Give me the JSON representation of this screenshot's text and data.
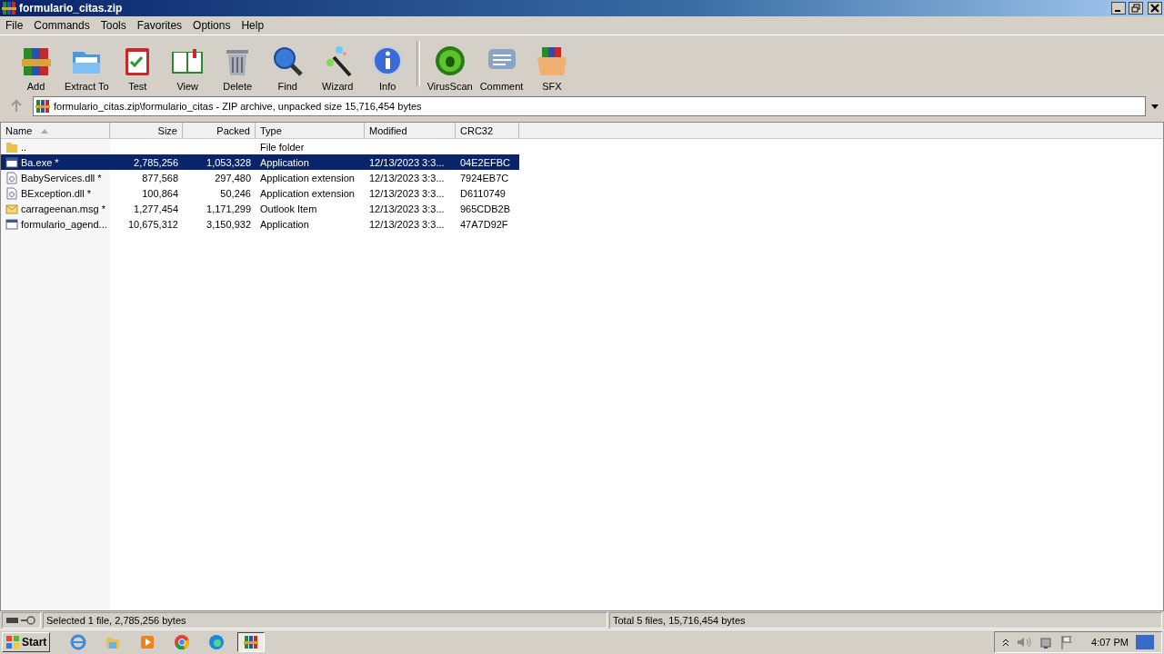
{
  "window": {
    "title": "formulario_citas.zip"
  },
  "menu": [
    "File",
    "Commands",
    "Tools",
    "Favorites",
    "Options",
    "Help"
  ],
  "toolbar": [
    {
      "label": "Add",
      "kind": "add"
    },
    {
      "label": "Extract To",
      "kind": "extract"
    },
    {
      "label": "Test",
      "kind": "test"
    },
    {
      "label": "View",
      "kind": "view"
    },
    {
      "label": "Delete",
      "kind": "delete"
    },
    {
      "label": "Find",
      "kind": "find"
    },
    {
      "label": "Wizard",
      "kind": "wizard"
    },
    {
      "label": "Info",
      "kind": "info"
    },
    {
      "label": "VirusScan",
      "kind": "virus"
    },
    {
      "label": "Comment",
      "kind": "comment"
    },
    {
      "label": "SFX",
      "kind": "sfx"
    }
  ],
  "address": "formulario_citas.zip\\formulario_citas - ZIP archive, unpacked size 15,716,454 bytes",
  "table": {
    "columns": [
      "Name",
      "Size",
      "Packed",
      "Type",
      "Modified",
      "CRC32"
    ],
    "rows": [
      {
        "kind": "folder",
        "selected": false,
        "cells": [
          "..",
          "",
          "",
          "File folder",
          "",
          ""
        ]
      },
      {
        "kind": "exe",
        "selected": true,
        "cells": [
          "Ba.exe *",
          "2,785,256",
          "1,053,328",
          "Application",
          "12/13/2023 3:3...",
          "04E2EFBC"
        ]
      },
      {
        "kind": "dll",
        "selected": false,
        "cells": [
          "BabyServices.dll *",
          "877,568",
          "297,480",
          "Application extension",
          "12/13/2023 3:3...",
          "7924EB7C"
        ]
      },
      {
        "kind": "dll",
        "selected": false,
        "cells": [
          "BException.dll *",
          "100,864",
          "50,246",
          "Application extension",
          "12/13/2023 3:3...",
          "D6110749"
        ]
      },
      {
        "kind": "msg",
        "selected": false,
        "cells": [
          "carrageenan.msg *",
          "1,277,454",
          "1,171,299",
          "Outlook Item",
          "12/13/2023 3:3...",
          "965CDB2B"
        ]
      },
      {
        "kind": "exe",
        "selected": false,
        "cells": [
          "formulario_agend...",
          "10,675,312",
          "3,150,932",
          "Application",
          "12/13/2023 3:3...",
          "47A7D92F"
        ]
      }
    ]
  },
  "status_bar": {
    "left": "Selected 1 file, 2,785,256 bytes",
    "right": "Total 5 files, 15,716,454 bytes"
  },
  "taskbar": {
    "start": "Start",
    "apps": [
      {
        "kind": "ie",
        "selected": false
      },
      {
        "kind": "explorer",
        "selected": false
      },
      {
        "kind": "media",
        "selected": false
      },
      {
        "kind": "chrome",
        "selected": false
      },
      {
        "kind": "edge",
        "selected": false
      },
      {
        "kind": "rar",
        "selected": true
      }
    ],
    "clock": "4:07 PM"
  }
}
